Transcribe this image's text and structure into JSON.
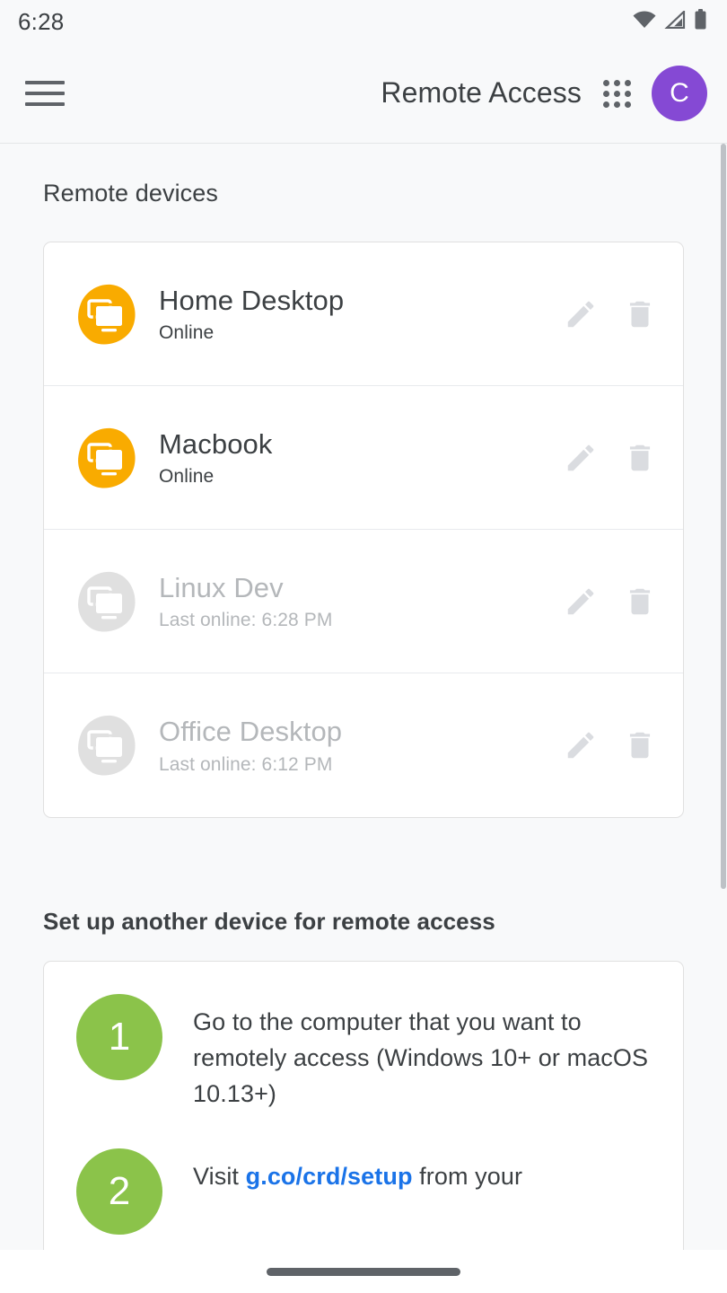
{
  "status_bar": {
    "time": "6:28",
    "icons": [
      "wifi-icon",
      "cell-signal-icon",
      "battery-icon"
    ]
  },
  "toolbar": {
    "menu_icon": "hamburger-menu-icon",
    "title": "Remote Access",
    "apps_icon": "apps-grid-icon",
    "avatar_initial": "C",
    "avatar_color": "#8549d4"
  },
  "devices_section": {
    "title": "Remote devices",
    "online_icon_color": "#f9ab00",
    "offline_icon_color": "#e0e0e0",
    "devices": [
      {
        "name": "Home Desktop",
        "status": "Online",
        "online": true,
        "edit_label": "edit-icon",
        "delete_label": "delete-icon"
      },
      {
        "name": "Macbook",
        "status": "Online",
        "online": true,
        "edit_label": "edit-icon",
        "delete_label": "delete-icon"
      },
      {
        "name": "Linux Dev",
        "status": "Last online: 6:28 PM",
        "online": false,
        "edit_label": "edit-icon",
        "delete_label": "delete-icon"
      },
      {
        "name": "Office Desktop",
        "status": "Last online: 6:12 PM",
        "online": false,
        "edit_label": "edit-icon",
        "delete_label": "delete-icon"
      }
    ]
  },
  "setup_section": {
    "title": "Set up another device for remote access",
    "badge_color": "#8bc34a",
    "link_color": "#1a73e8",
    "steps": [
      {
        "number": "1",
        "text_before": "Go to the computer that you want to remotely access (Windows 10+ or macOS 10.13+)",
        "link": "",
        "text_after": ""
      },
      {
        "number": "2",
        "text_before": "Visit ",
        "link": "g.co/crd/setup",
        "text_after": " from your"
      }
    ]
  },
  "nav_bar": {
    "pill": "gesture-nav-pill"
  }
}
